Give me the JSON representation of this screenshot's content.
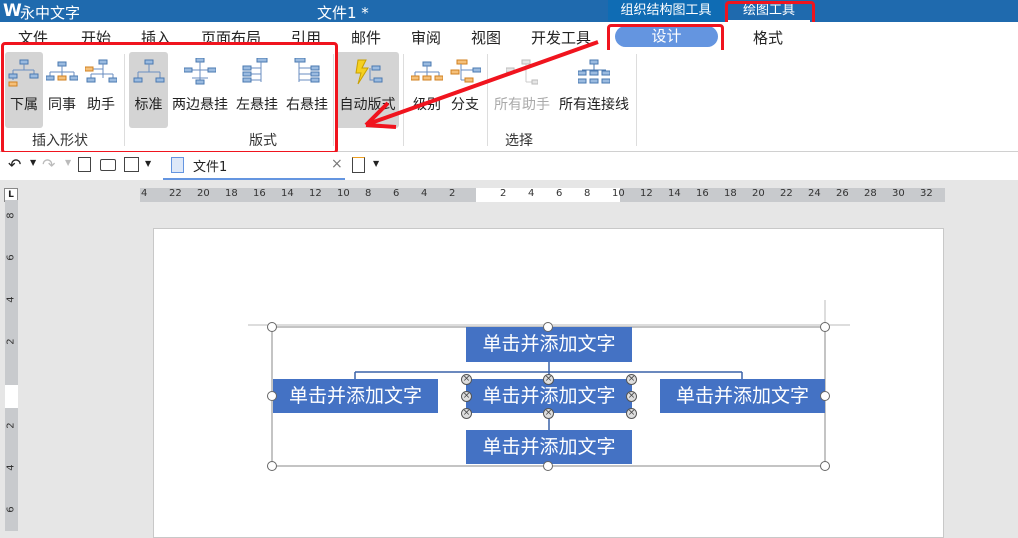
{
  "app": {
    "name": "永中文字",
    "doc_title": "文件1 *",
    "logo": "W"
  },
  "context_tabs": [
    "组织结构图工具",
    "绘图工具"
  ],
  "menu": [
    "文件",
    "开始",
    "插入",
    "页面布局",
    "引用",
    "邮件",
    "审阅",
    "视图",
    "开发工具",
    "设计",
    "格式"
  ],
  "active_menu": "设计",
  "ribbon": {
    "insert_shape": {
      "label": "插入形状",
      "buttons": [
        "下属",
        "同事",
        "助手"
      ]
    },
    "layout": {
      "label": "版式",
      "buttons": [
        "标准",
        "两边悬挂",
        "左悬挂",
        "右悬挂"
      ]
    },
    "auto_layout": "自动版式",
    "select": {
      "label": "选择",
      "buttons": [
        "级别",
        "分支",
        "所有助手",
        "所有连接线"
      ]
    }
  },
  "toolbar": {
    "doc_tab": "文件1"
  },
  "ruler": {
    "left": [
      "4",
      "22",
      "20",
      "18",
      "16",
      "14",
      "12",
      "10",
      "8",
      "6",
      "4",
      "2"
    ],
    "right": [
      "2",
      "4",
      "6",
      "8",
      "10",
      "12",
      "14",
      "16",
      "18",
      "20",
      "22",
      "24",
      "26",
      "28",
      "30",
      "32"
    ],
    "vertical_top": [
      "8",
      "6",
      "4",
      "2"
    ],
    "vertical_bottom": [
      "2",
      "4",
      "6"
    ]
  },
  "org_chart": {
    "top": "单击并添加文字",
    "left": "单击并添加文字",
    "center": "单击并添加文字",
    "right": "单击并添加文字",
    "bottom": "单击并添加文字"
  },
  "colors": {
    "title_bar": "#1f6aae",
    "active_tab": "#6495e0",
    "shape_fill": "#4472c4",
    "annotation": "#f0141e"
  }
}
